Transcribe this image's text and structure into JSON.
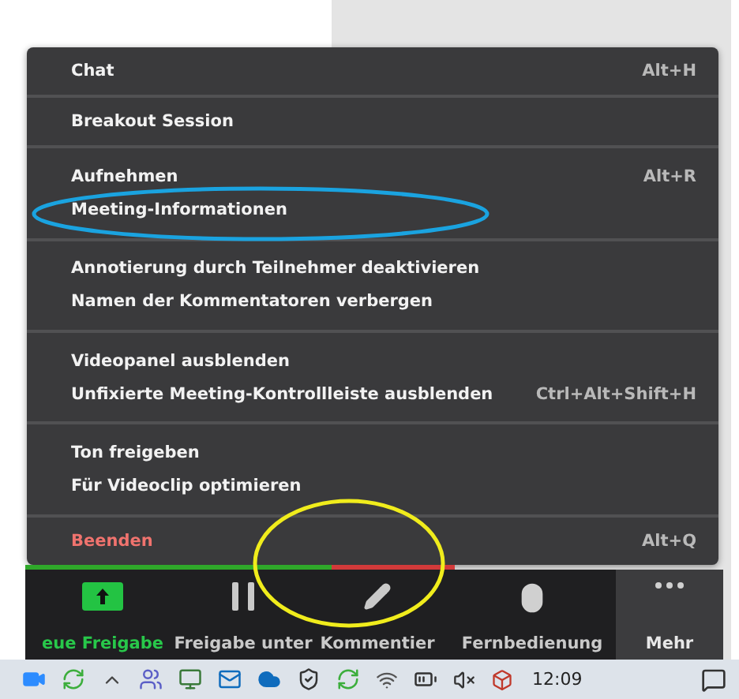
{
  "menu": {
    "groups": [
      {
        "items": [
          {
            "label": "Chat",
            "shortcut": "Alt+H",
            "kind": "normal"
          }
        ]
      },
      {
        "items": [
          {
            "label": "Breakout Session",
            "kind": "normal"
          }
        ]
      },
      {
        "items": [
          {
            "label": "Aufnehmen",
            "shortcut": "Alt+R",
            "kind": "normal"
          },
          {
            "label": "Meeting-Informationen",
            "kind": "normal"
          }
        ]
      },
      {
        "items": [
          {
            "label": "Annotierung durch Teilnehmer deaktivieren",
            "kind": "normal"
          },
          {
            "label": "Namen der Kommentatoren verbergen",
            "kind": "normal"
          }
        ]
      },
      {
        "items": [
          {
            "label": "Videopanel ausblenden",
            "kind": "normal"
          },
          {
            "label": "Unfixierte Meeting-Kontrollleiste ausblenden",
            "shortcut": "Ctrl+Alt+Shift+H",
            "kind": "normal"
          }
        ]
      },
      {
        "items": [
          {
            "label": "Ton freigeben",
            "kind": "normal"
          },
          {
            "label": "Für Videoclip optimieren",
            "kind": "normal"
          }
        ]
      },
      {
        "items": [
          {
            "label": "Beenden",
            "shortcut": "Alt+Q",
            "kind": "danger"
          }
        ]
      }
    ]
  },
  "toolbar": {
    "buttons": [
      {
        "label": "eue Freigabe",
        "kind": "share",
        "selected": false
      },
      {
        "label": "Freigabe unter",
        "kind": "pause",
        "selected": false
      },
      {
        "label": "Kommentier",
        "kind": "annotate",
        "selected": false
      },
      {
        "label": "Fernbedienung",
        "kind": "remote",
        "selected": false
      },
      {
        "label": "Mehr",
        "kind": "more",
        "selected": true
      }
    ]
  },
  "taskbar": {
    "time": "12:09"
  },
  "annotations": [
    {
      "color": "#1aa3e0"
    },
    {
      "color": "#f0ec1c"
    }
  ]
}
